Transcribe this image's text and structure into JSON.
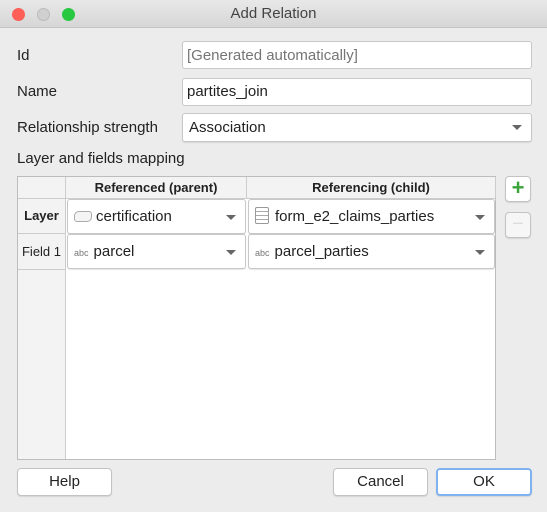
{
  "window": {
    "title": "Add Relation"
  },
  "form": {
    "id_label": "Id",
    "id_placeholder": "[Generated automatically]",
    "id_value": "",
    "name_label": "Name",
    "name_value": "partites_join",
    "strength_label": "Relationship strength",
    "strength_value": "Association",
    "mapping_label": "Layer and fields mapping"
  },
  "table": {
    "columns": [
      "Referenced (parent)",
      "Referencing (child)"
    ],
    "rows": [
      {
        "header": "Layer",
        "parent": "certification",
        "child": "form_e2_claims_parties",
        "parent_icon": "polygon-layer-icon",
        "child_icon": "table-layer-icon"
      },
      {
        "header": "Field 1",
        "parent": "parcel",
        "child": "parcel_parties",
        "parent_icon": "abc",
        "child_icon": "abc"
      }
    ]
  },
  "buttons": {
    "help": "Help",
    "cancel": "Cancel",
    "ok": "OK",
    "add": "+",
    "remove": "−"
  },
  "colors": {
    "close": "#fe5f57",
    "minimize": "#d0d0d0",
    "zoom": "#28c840",
    "ok_border": "#7fb2f0",
    "add_icon": "#3aa33a"
  }
}
